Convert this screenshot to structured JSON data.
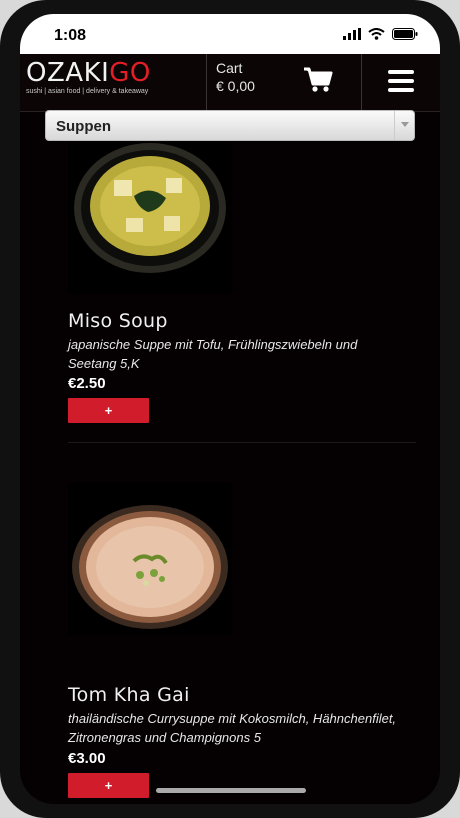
{
  "status_bar": {
    "time": "1:08"
  },
  "header": {
    "logo_part1": "OZAKI",
    "logo_part2": "GO",
    "tagline": "sushi | asian food | delivery & takeaway",
    "cart_label": "Cart",
    "cart_total": "€ 0,00"
  },
  "category": {
    "selected": "Suppen"
  },
  "products": [
    {
      "name": "Miso Soup",
      "description": "japanische Suppe mit Tofu, Frühlingszwiebeln und Seetang 5,K",
      "price": "€2.50",
      "add_label": "+"
    },
    {
      "name": "Tom Kha Gai",
      "description": "thailändische Currysuppe mit Kokosmilch, Hähnchenfilet, Zitronengras und Champignons 5",
      "price": "€3.00",
      "add_label": "+"
    }
  ],
  "colors": {
    "accent": "#d11d2b",
    "logo_red": "#e21f26",
    "background": "#050001"
  }
}
